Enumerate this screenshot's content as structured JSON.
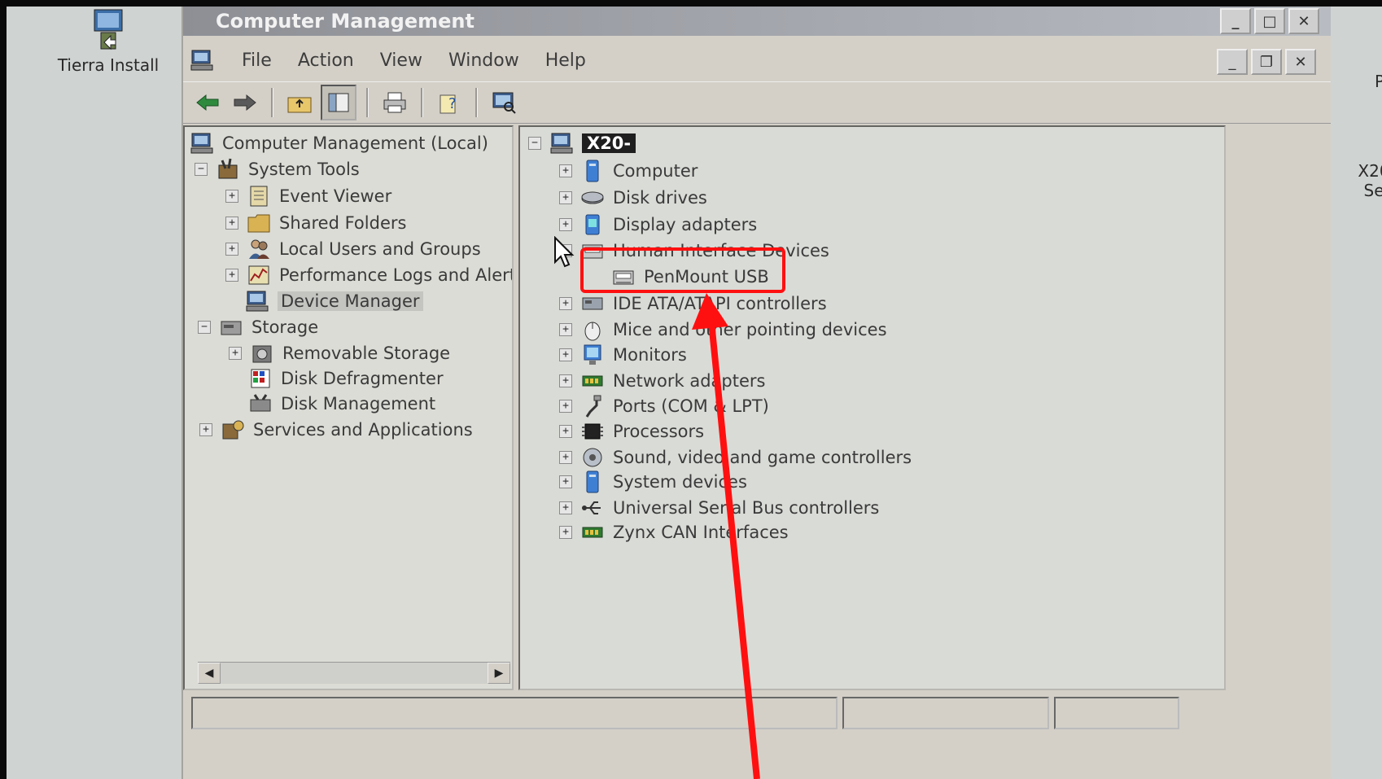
{
  "desktop": {
    "left_icon_label": "Tierra Install",
    "right_icon_label_1": "P",
    "right_icon_label_2": "X20",
    "right_icon_label_3": "Se"
  },
  "window": {
    "title": "Computer Management",
    "menu": [
      "File",
      "Action",
      "View",
      "Window",
      "Help"
    ]
  },
  "left_tree": [
    {
      "label": "Computer Management (Local)",
      "icon": "computer-icon"
    },
    {
      "label": "System Tools",
      "icon": "tools-icon"
    },
    {
      "label": "Event Viewer",
      "icon": "event-viewer-icon"
    },
    {
      "label": "Shared Folders",
      "icon": "folder-icon"
    },
    {
      "label": "Local Users and Groups",
      "icon": "users-icon"
    },
    {
      "label": "Performance Logs and Alerts",
      "icon": "performance-icon"
    },
    {
      "label": "Device Manager",
      "icon": "device-manager-icon",
      "selected": true
    },
    {
      "label": "Storage",
      "icon": "storage-icon"
    },
    {
      "label": "Removable Storage",
      "icon": "removable-storage-icon"
    },
    {
      "label": "Disk Defragmenter",
      "icon": "defrag-icon"
    },
    {
      "label": "Disk Management",
      "icon": "disk-management-icon"
    },
    {
      "label": "Services and Applications",
      "icon": "services-icon"
    }
  ],
  "right_tree": {
    "root": "X20-",
    "items": [
      {
        "label": "Computer"
      },
      {
        "label": "Disk drives"
      },
      {
        "label": "Display adapters"
      },
      {
        "label": "Human Interface Devices"
      },
      {
        "label": "PenMount USB"
      },
      {
        "label": "IDE ATA/ATAPI controllers"
      },
      {
        "label": "Mice and other pointing devices"
      },
      {
        "label": "Monitors"
      },
      {
        "label": "Network adapters"
      },
      {
        "label": "Ports (COM & LPT)"
      },
      {
        "label": "Processors"
      },
      {
        "label": "Sound, video and game controllers"
      },
      {
        "label": "System devices"
      },
      {
        "label": "Universal Serial Bus controllers"
      },
      {
        "label": "Zynx CAN Interfaces"
      }
    ]
  },
  "colors": {
    "annotation": "#ff1010",
    "selection": "#c4c4c0",
    "root_highlight": "#1f1f1f"
  }
}
